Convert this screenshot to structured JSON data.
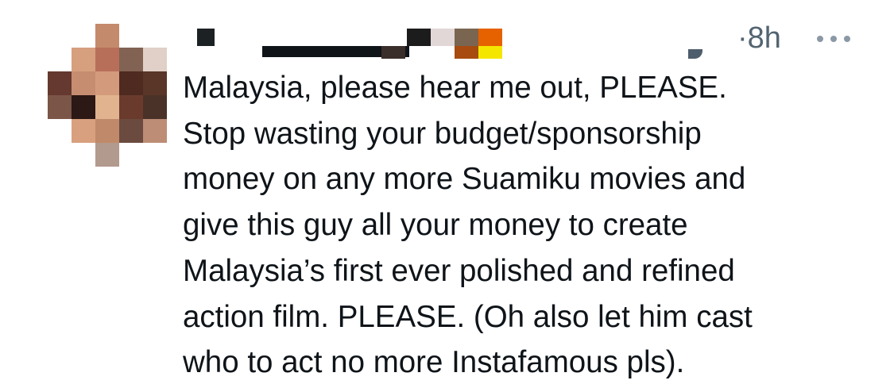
{
  "tweet": {
    "timestamp": "8h",
    "dot": "·",
    "more_icon": "more-horizontal-icon",
    "lines": [
      "Malaysia, please hear me out, PLEASE.",
      "Stop wasting your budget/sponsorship",
      "money on any more Suamiku movies and",
      "give this guy all your money to create",
      "Malaysia’s first ever polished and refined",
      "action film. PLEASE. (Oh also let him cast",
      "who to act no more Instafamous pls)."
    ]
  },
  "colors": {
    "text": "#0f1419",
    "muted": "#536471"
  }
}
